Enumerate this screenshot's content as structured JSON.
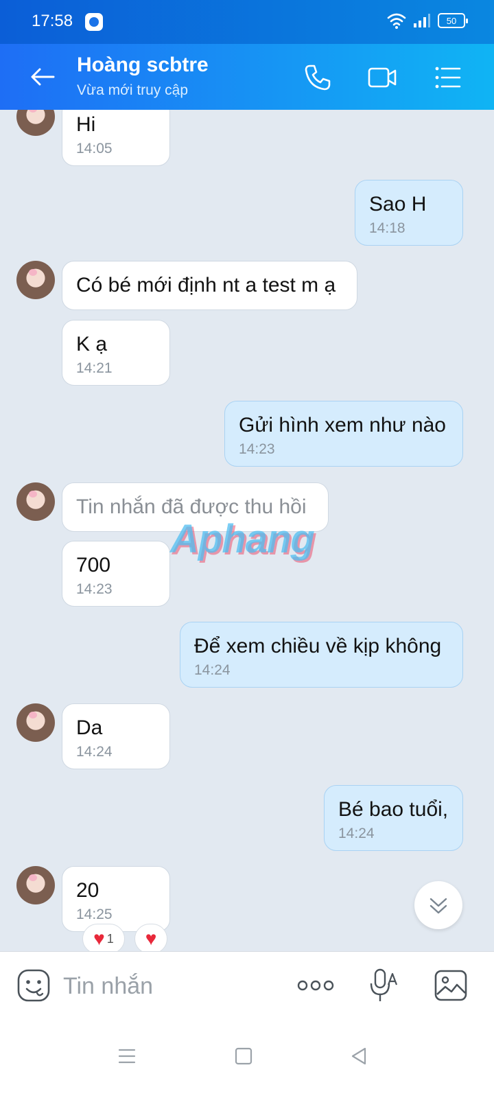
{
  "status_bar": {
    "time": "17:58",
    "battery": "50"
  },
  "header": {
    "contact_name": "Hoàng scbtre",
    "contact_status": "Vừa mới truy cập"
  },
  "messages": [
    {
      "dir": "in",
      "text": "Hi",
      "time": "14:05"
    },
    {
      "dir": "out",
      "text": "Sao H",
      "time": "14:18"
    },
    {
      "dir": "in",
      "text": "Có bé mới định nt a test m ạ"
    },
    {
      "dir": "in",
      "text": "K ạ",
      "time": "14:21"
    },
    {
      "dir": "out",
      "text": "Gửi hình xem như nào",
      "time": "14:23"
    },
    {
      "dir": "in",
      "text": "Tin nhắn đã được thu hồi",
      "recalled": true
    },
    {
      "dir": "in",
      "text": "700",
      "time": "14:23"
    },
    {
      "dir": "out",
      "text": "Để xem chiều về kịp không",
      "time": "14:24"
    },
    {
      "dir": "in",
      "text": "Da",
      "time": "14:24"
    },
    {
      "dir": "out",
      "text": "Bé bao tuổi,",
      "time": "14:24"
    },
    {
      "dir": "in",
      "text": "20",
      "time": "14:25",
      "reaction_count": "1"
    }
  ],
  "watermark": "Aphang",
  "composer": {
    "placeholder": "Tin nhắn"
  },
  "icons": {
    "back": "arrow-left",
    "call": "phone",
    "video": "video-camera",
    "menu": "list",
    "sticker": "smiley",
    "more": "three-dots",
    "mic": "microphone",
    "image": "picture",
    "scroll_down": "double-chevron-down",
    "reaction": "heart"
  },
  "colors": {
    "header_start": "#1e6ef5",
    "header_end": "#10b4f4",
    "outgoing_bubble": "#d5ecfd",
    "incoming_bubble": "#ffffff",
    "chat_bg": "#e2e9f1",
    "heart": "#e8283a"
  }
}
